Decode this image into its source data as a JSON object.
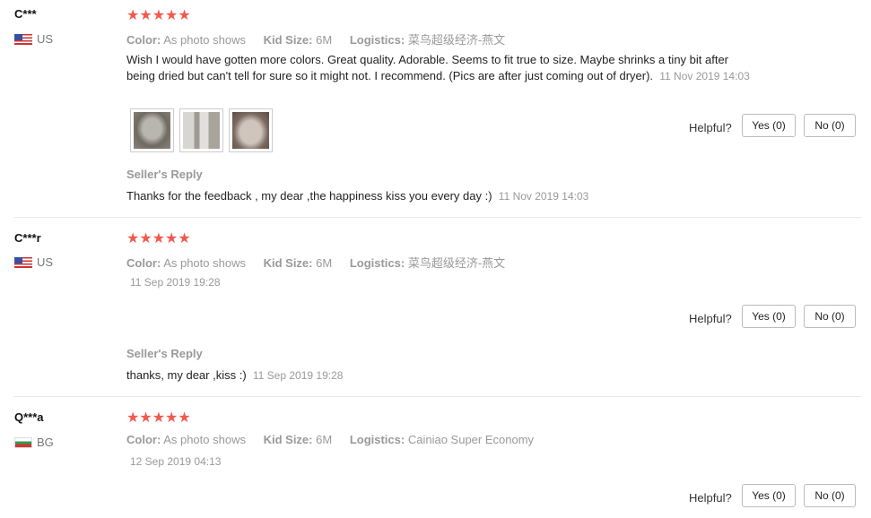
{
  "labels": {
    "color": "Color:",
    "kid_size": "Kid Size:",
    "logistics": "Logistics:",
    "helpful": "Helpful?",
    "seller_reply": "Seller's Reply"
  },
  "reviews": [
    {
      "user": "C***",
      "country": "US",
      "rating": 5,
      "stars": "★★★★★",
      "color": "As photo shows",
      "kid_size": "6M",
      "logistics": "菜鸟超级经济-燕文",
      "text": "Wish I would have gotten more colors. Great quality. Adorable. Seems to fit true to size. Maybe shrinks a tiny bit after being dried but can't tell for sure so it might not. I recommend. (Pics are after just coming out of dryer).",
      "date": "11 Nov 2019 14:03",
      "helpful_yes": "Yes (0)",
      "helpful_no": "No (0)",
      "seller_reply": "Thanks for the feedback , my dear ,the happiness kiss you every day :)",
      "seller_reply_date": "11 Nov 2019 14:03"
    },
    {
      "user": "C***r",
      "country": "US",
      "rating": 5,
      "stars": "★★★★★",
      "color": "As photo shows",
      "kid_size": "6M",
      "logistics": "菜鸟超级经济-燕文",
      "date": "11 Sep 2019 19:28",
      "helpful_yes": "Yes (0)",
      "helpful_no": "No (0)",
      "seller_reply": "thanks, my dear ,kiss :)",
      "seller_reply_date": "11 Sep 2019 19:28"
    },
    {
      "user": "Q***a",
      "country": "BG",
      "rating": 5,
      "stars": "★★★★★",
      "color": "As photo shows",
      "kid_size": "6M",
      "logistics": "Cainiao Super Economy",
      "date": "12 Sep 2019 04:13",
      "helpful_yes": "Yes (0)",
      "helpful_no": "No (0)"
    }
  ],
  "colors": {
    "star": "#f05a4f",
    "muted_text": "#999999",
    "divider": "#e8e8e8"
  }
}
